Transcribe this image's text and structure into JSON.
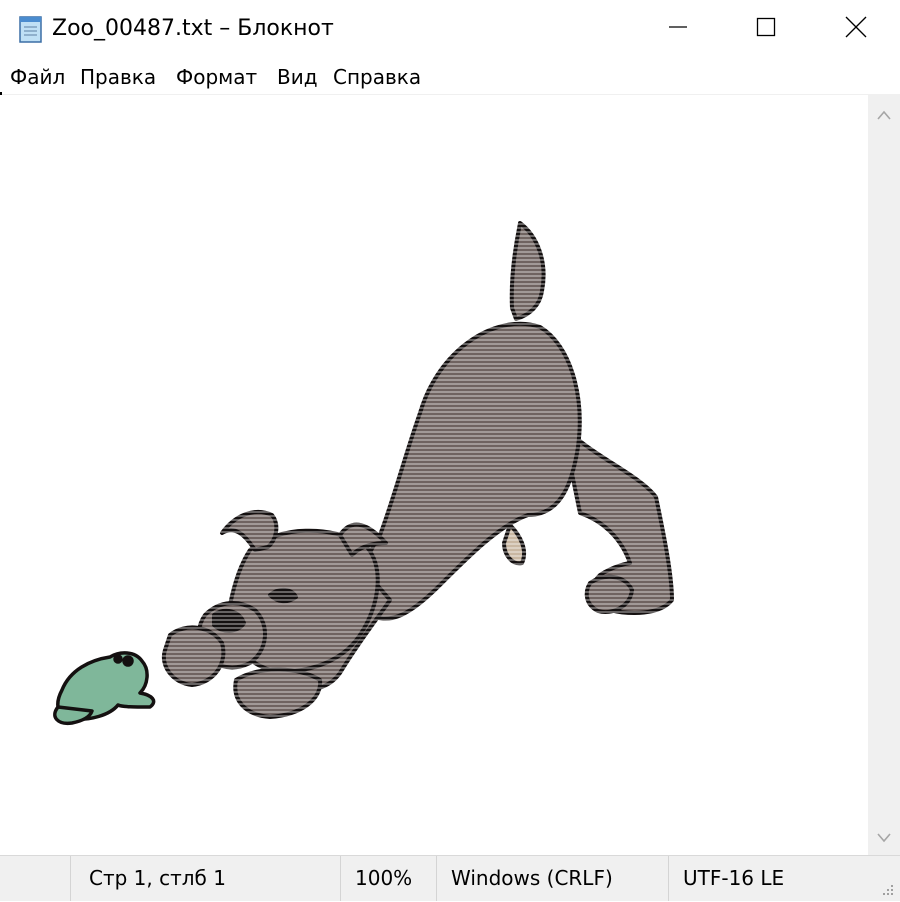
{
  "window": {
    "title": "Zoo_00487.txt – Блокнот",
    "icon": "notepad-icon"
  },
  "menu": {
    "items": [
      {
        "label": "Файл"
      },
      {
        "label": "Правка"
      },
      {
        "label": "Формат"
      },
      {
        "label": "Вид"
      },
      {
        "label": "Справка"
      }
    ]
  },
  "statusbar": {
    "position": "Стр 1, стлб 1",
    "zoom": "100%",
    "line_endings": "Windows (CRLF)",
    "encoding": "UTF-16 LE"
  },
  "colors": {
    "dog": "#6f6360",
    "dog_outline": "#141010",
    "frog": "#7fb79a",
    "tan": "#c9b7a2",
    "ui_gray": "#f0f0f0"
  }
}
